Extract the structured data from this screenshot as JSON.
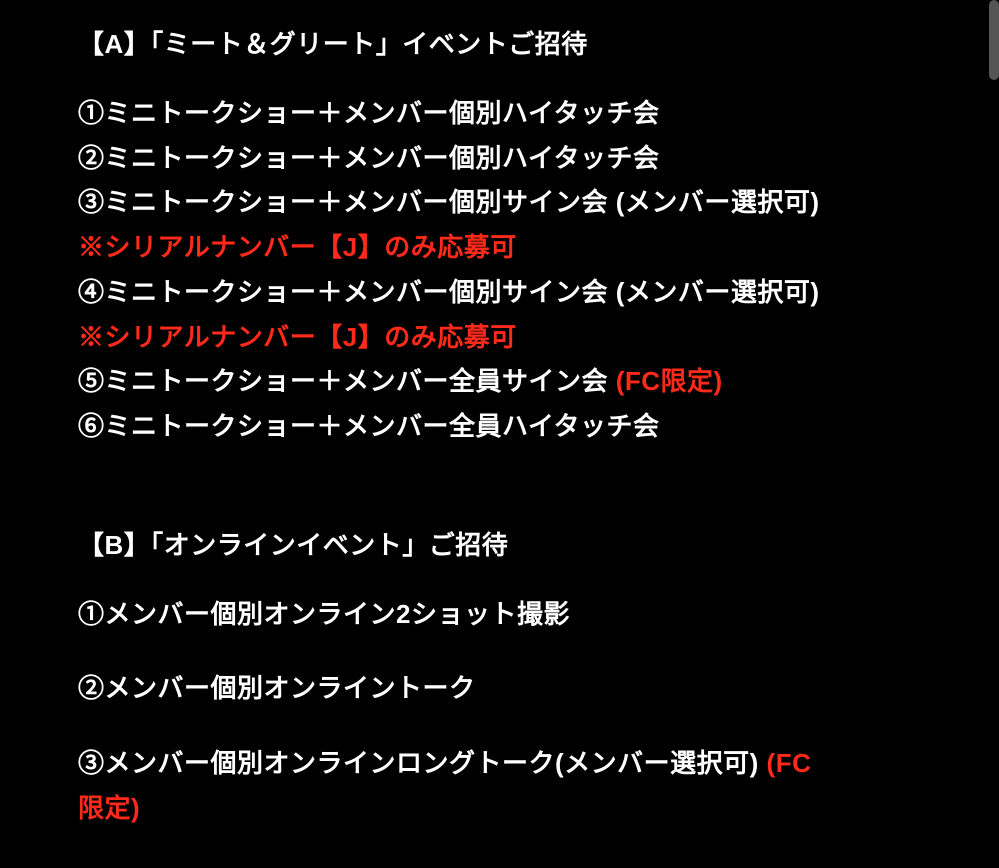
{
  "sectionA": {
    "title": "【A】「ミート＆グリート」イベントご招待",
    "items": [
      "①ミニトークショー＋メンバー個別ハイタッチ会",
      "②ミニトークショー＋メンバー個別ハイタッチ会",
      "③ミニトークショー＋メンバー個別サイン会 (メンバー選択可)"
    ],
    "note1": "※シリアルナンバー【J】のみ応募可",
    "item4": "④ミニトークショー＋メンバー個別サイン会 (メンバー選択可)",
    "note2": "※シリアルナンバー【J】のみ応募可",
    "item5": "⑤ミニトークショー＋メンバー全員サイン会",
    "item5_suffix": " (FC限定)",
    "item6": "⑥ミニトークショー＋メンバー全員ハイタッチ会"
  },
  "sectionB": {
    "title": "【B】「オンラインイベント」ご招待",
    "item1": "①メンバー個別オンライン2ショット撮影",
    "item2": "②メンバー個別オンライントーク",
    "item3": "③メンバー個別オンラインロングトーク(メンバー選択可)",
    "item3_suffix_a": " (FC",
    "item3_suffix_b": "限定)"
  }
}
